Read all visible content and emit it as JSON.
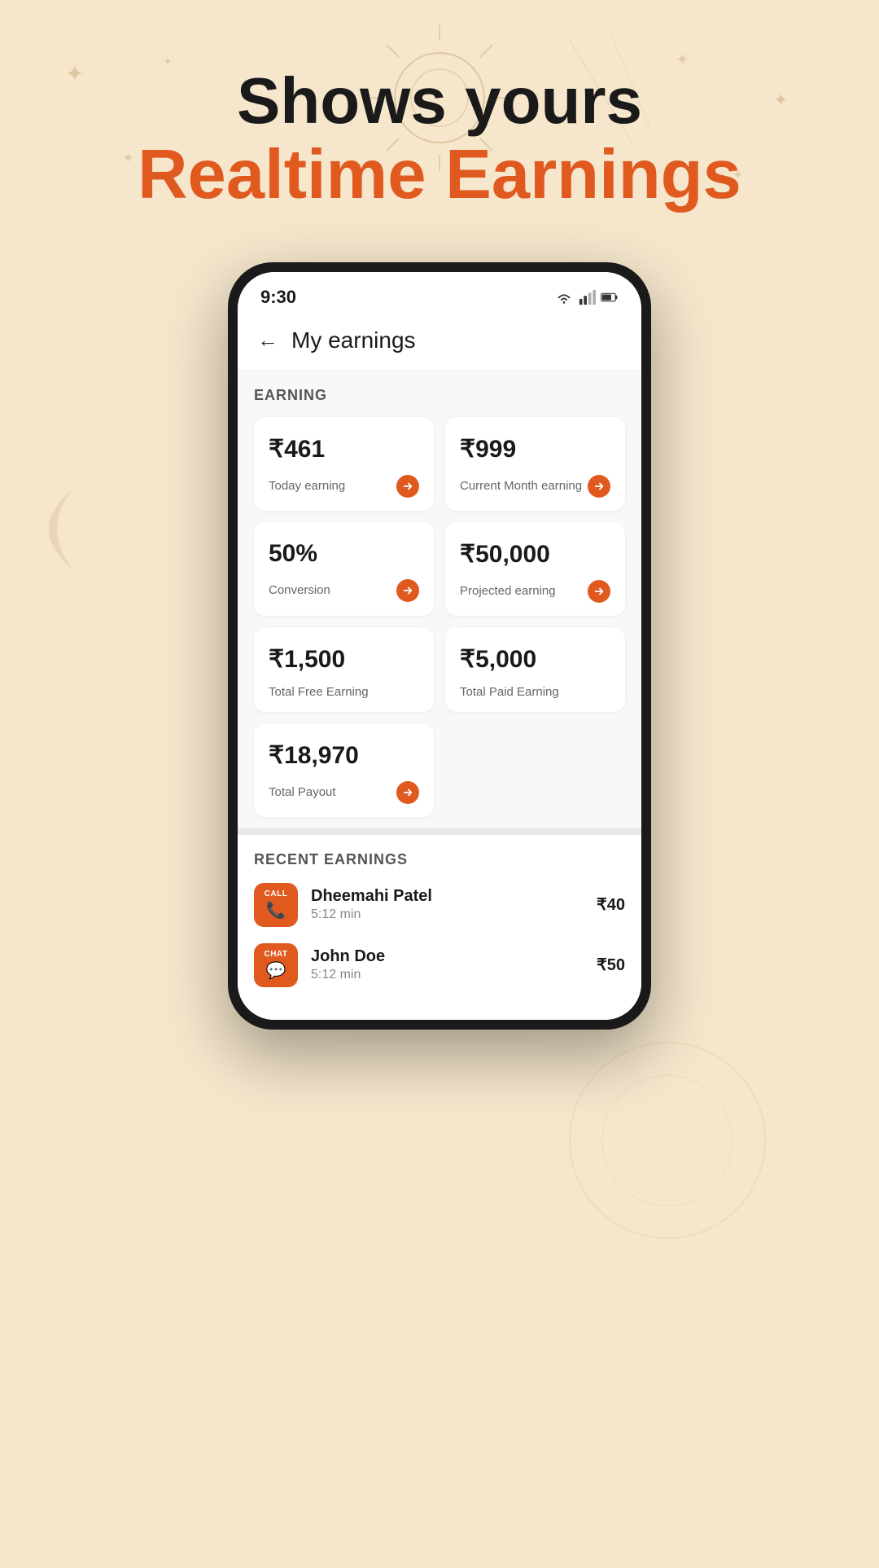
{
  "background": {
    "color": "#f5e6cc"
  },
  "promo": {
    "line1": "Shows yours",
    "line2": "Realtime Earnings"
  },
  "status_bar": {
    "time": "9:30"
  },
  "app_header": {
    "back_label": "←",
    "title": "My earnings"
  },
  "earning_section": {
    "label": "EARNING",
    "cards": [
      {
        "value": "₹461",
        "label": "Today earning",
        "has_arrow": true
      },
      {
        "value": "₹999",
        "label": "Current Month earning",
        "has_arrow": true
      },
      {
        "value": "50%",
        "label": "Conversion",
        "has_arrow": true
      },
      {
        "value": "₹50,000",
        "label": "Projected earning",
        "has_arrow": true
      },
      {
        "value": "₹1,500",
        "label": "Total Free Earning",
        "has_arrow": false
      },
      {
        "value": "₹5,000",
        "label": "Total Paid Earning",
        "has_arrow": false
      }
    ],
    "payout_card": {
      "value": "₹18,970",
      "label": "Total Payout",
      "has_arrow": true
    }
  },
  "recent_section": {
    "label": "RECENT EARNINGS",
    "items": [
      {
        "type": "CALL",
        "name": "Dheemahi Patel",
        "duration": "5:12 min",
        "amount": "₹40"
      },
      {
        "type": "CHAT",
        "name": "John Doe",
        "duration": "5:12 min",
        "amount": "₹50"
      }
    ]
  }
}
